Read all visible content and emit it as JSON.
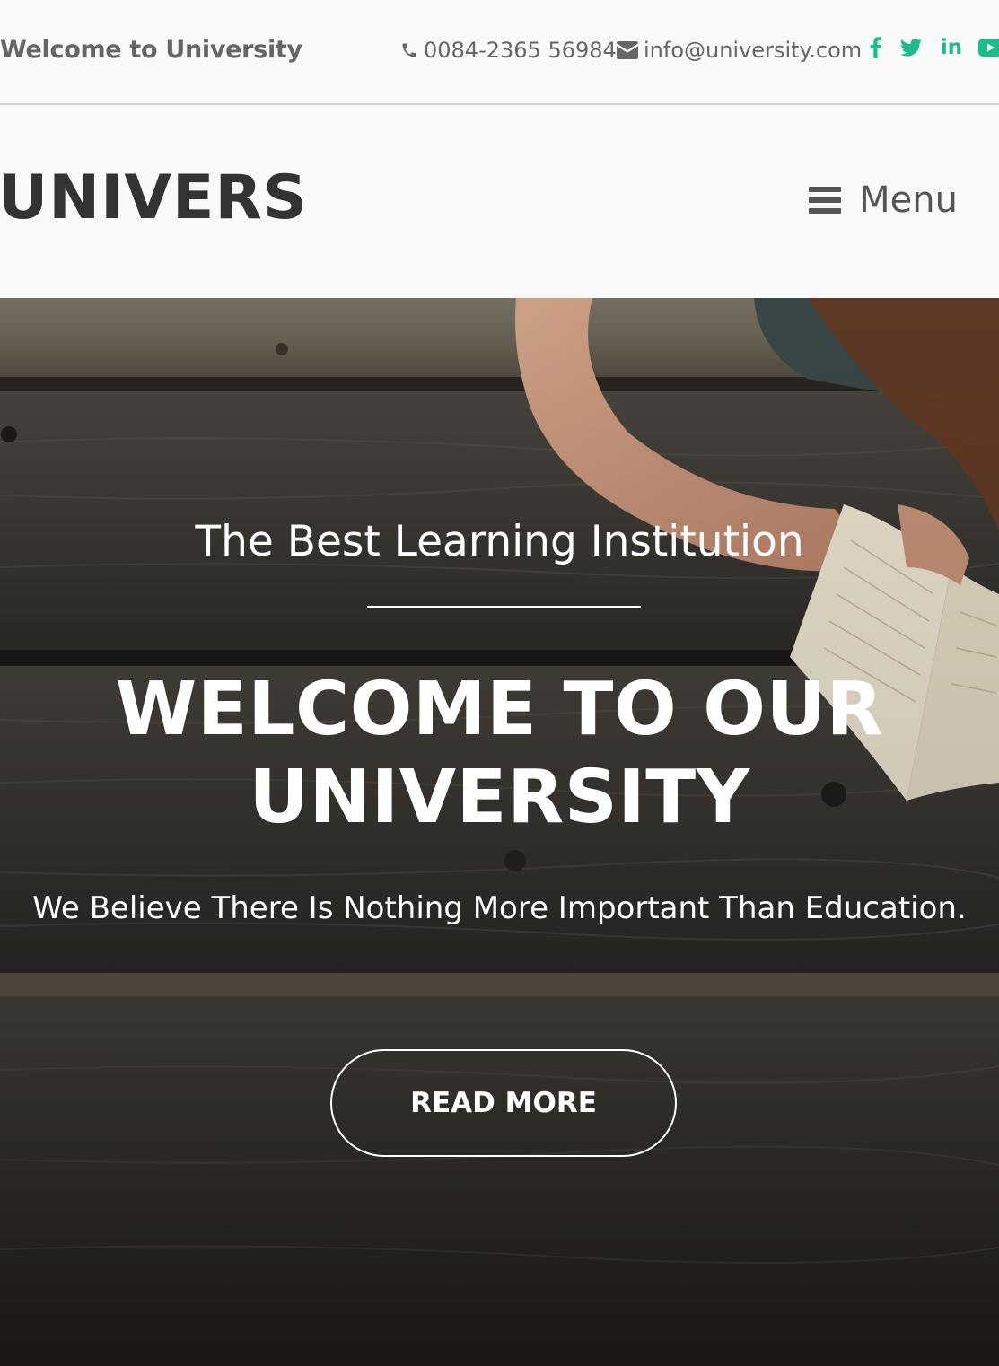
{
  "topbar": {
    "welcome": "Welcome to University",
    "phone": "0084-2365 56984",
    "email": "info@university.com",
    "social": [
      {
        "icon": "facebook-icon"
      },
      {
        "icon": "twitter-icon"
      },
      {
        "icon": "linkedin-icon"
      },
      {
        "icon": "youtube-icon"
      }
    ]
  },
  "header": {
    "logo": "UNIVERS",
    "menu_label": "Menu"
  },
  "hero": {
    "subtitle": "The Best Learning Institution",
    "title_line1": "WELCOME TO OUR",
    "title_line2": "UNIVERSITY",
    "description": "We Believe There Is Nothing More Important Than Education.",
    "cta_label": "READ MORE"
  },
  "colors": {
    "accent": "#1abc8c",
    "text_dark": "#333333",
    "text_muted": "#666666"
  }
}
